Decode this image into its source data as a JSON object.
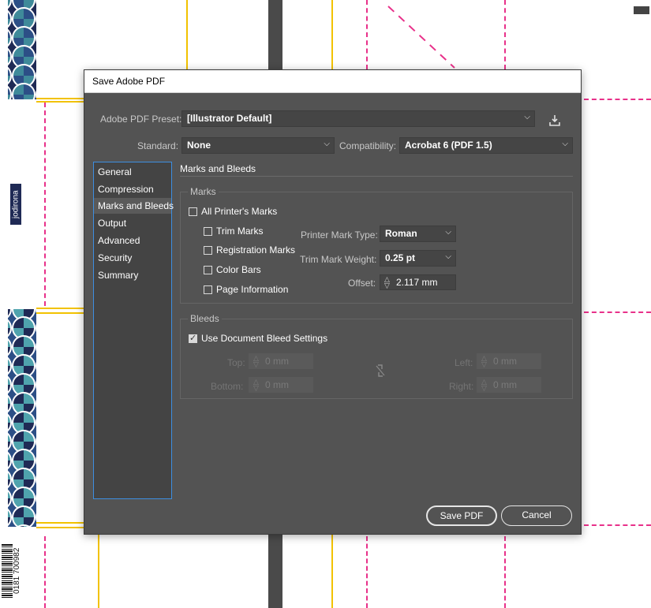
{
  "background": {
    "tag_text": "jodirona",
    "barcode_text": "0181 700982"
  },
  "dialog": {
    "title": "Save Adobe PDF",
    "preset": {
      "label": "Adobe PDF Preset:",
      "value": "[Illustrator Default]"
    },
    "standard": {
      "label": "Standard:",
      "value": "None"
    },
    "compatibility": {
      "label": "Compatibility:",
      "value": "Acrobat 6 (PDF 1.5)"
    },
    "nav": [
      {
        "label": "General"
      },
      {
        "label": "Compression"
      },
      {
        "label": "Marks and Bleeds",
        "selected": true
      },
      {
        "label": "Output"
      },
      {
        "label": "Advanced"
      },
      {
        "label": "Security"
      },
      {
        "label": "Summary"
      }
    ],
    "panel_title": "Marks and Bleeds",
    "marks": {
      "legend": "Marks",
      "all_printers_marks": {
        "label": "All Printer's Marks",
        "checked": false
      },
      "trim_marks": {
        "label": "Trim Marks",
        "checked": false
      },
      "registration_marks": {
        "label": "Registration Marks",
        "checked": false
      },
      "color_bars": {
        "label": "Color Bars",
        "checked": false
      },
      "page_information": {
        "label": "Page Information",
        "checked": false
      },
      "printer_mark_type": {
        "label": "Printer Mark Type:",
        "value": "Roman"
      },
      "trim_mark_weight": {
        "label": "Trim Mark Weight:",
        "value": "0.25 pt"
      },
      "offset": {
        "label": "Offset:",
        "value": "2.117 mm"
      }
    },
    "bleeds": {
      "legend": "Bleeds",
      "use_document_bleed": {
        "label": "Use Document Bleed Settings",
        "checked": true
      },
      "top": {
        "label": "Top:",
        "value": "0 mm"
      },
      "bottom": {
        "label": "Bottom:",
        "value": "0 mm"
      },
      "left": {
        "label": "Left:",
        "value": "0 mm"
      },
      "right": {
        "label": "Right:",
        "value": "0 mm"
      }
    },
    "buttons": {
      "save": "Save PDF",
      "cancel": "Cancel"
    }
  },
  "colors": {
    "dialog_bg": "#535353",
    "accent": "#3d8ee0",
    "guide_yellow": "#f2c200",
    "guide_pink": "#e8318a",
    "scale_navy": "#1f2a55",
    "scale_teal": "#3f8a9a"
  }
}
